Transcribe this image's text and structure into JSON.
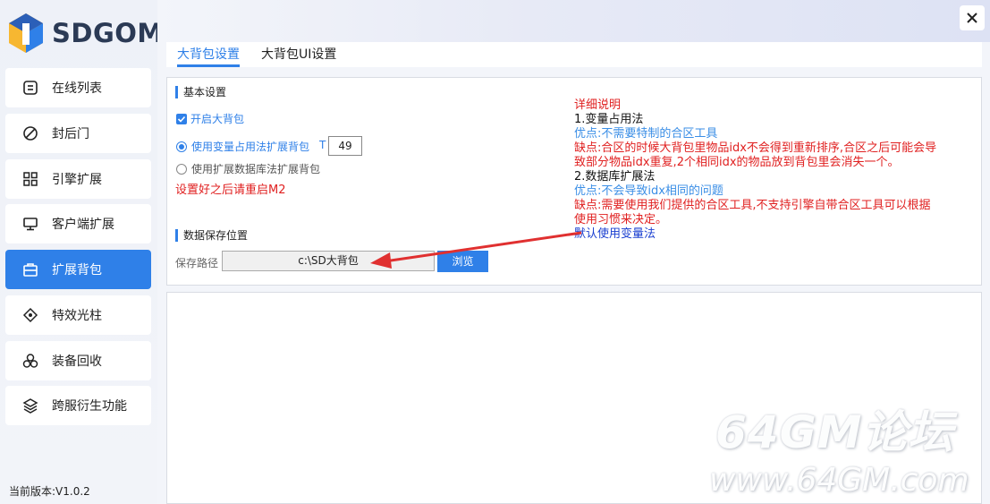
{
  "app": {
    "logo_text": "SDGOM",
    "version": "当前版本:V1.0.2"
  },
  "sidebar": {
    "items": [
      {
        "label": "在线列表",
        "icon": "list-icon",
        "active": false
      },
      {
        "label": "封后门",
        "icon": "block-icon",
        "active": false
      },
      {
        "label": "引擎扩展",
        "icon": "grid-icon",
        "active": false
      },
      {
        "label": "客户端扩展",
        "icon": "monitor-icon",
        "active": false
      },
      {
        "label": "扩展背包",
        "icon": "bag-icon",
        "active": true
      },
      {
        "label": "特效光柱",
        "icon": "sparkle-icon",
        "active": false
      },
      {
        "label": "装备回收",
        "icon": "recycle-icon",
        "active": false
      },
      {
        "label": "跨服衍生功能",
        "icon": "layers-icon",
        "active": false
      }
    ]
  },
  "tabs": [
    {
      "label": "大背包设置",
      "active": true
    },
    {
      "label": "大背包UI设置",
      "active": false
    }
  ],
  "basic": {
    "title": "基本设置",
    "enable_label": "开启大背包",
    "enable_checked": true,
    "radio_variable": "使用变量占用法扩展背包",
    "radio_variable_selected": true,
    "t_label": "T",
    "t_value": "49",
    "radio_db": "使用扩展数据库法扩展背包",
    "restart_note": "设置好之后请重启M2"
  },
  "storage": {
    "title": "数据保存位置",
    "path_label": "保存路径",
    "path_value": "c:\\SD大背包",
    "browse_label": "浏览"
  },
  "help": {
    "heading": "详细说明",
    "m1_title": "1.变量占用法",
    "m1_pro": "优点:不需要特制的合区工具",
    "m1_con_1": "缺点:合区的时候大背包里物品idx不会得到重新排序,合区之后可能会导",
    "m1_con_2": "致部分物品idx重复,2个相同idx的物品放到背包里会消失一个。",
    "m2_title": "2.数据库扩展法",
    "m2_pro": "优点:不会导致idx相同的问题",
    "m2_con_1": "缺点:需要使用我们提供的合区工具,不支持引擎自带合区工具可以根据",
    "m2_con_2": "使用习惯来决定。",
    "default_note": "默认使用变量法"
  },
  "watermark": {
    "line1": "64GM论坛",
    "line2": "www.64GM.com"
  },
  "colors": {
    "accent": "#2f80e8",
    "warning": "#e02020",
    "pro": "#3a8ee6",
    "default_note": "#1a3fd0"
  }
}
